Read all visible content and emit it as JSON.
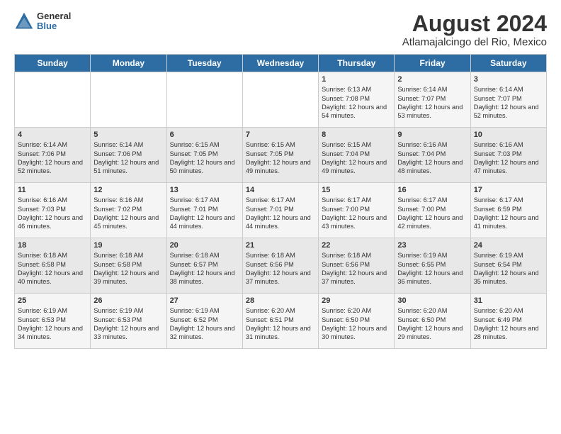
{
  "header": {
    "logo_general": "General",
    "logo_blue": "Blue",
    "main_title": "August 2024",
    "subtitle": "Atlamajalcingo del Rio, Mexico"
  },
  "days_of_week": [
    "Sunday",
    "Monday",
    "Tuesday",
    "Wednesday",
    "Thursday",
    "Friday",
    "Saturday"
  ],
  "weeks": [
    {
      "days": [
        {
          "num": "",
          "text": ""
        },
        {
          "num": "",
          "text": ""
        },
        {
          "num": "",
          "text": ""
        },
        {
          "num": "",
          "text": ""
        },
        {
          "num": "1",
          "text": "Sunrise: 6:13 AM\nSunset: 7:08 PM\nDaylight: 12 hours\nand 54 minutes."
        },
        {
          "num": "2",
          "text": "Sunrise: 6:14 AM\nSunset: 7:07 PM\nDaylight: 12 hours\nand 53 minutes."
        },
        {
          "num": "3",
          "text": "Sunrise: 6:14 AM\nSunset: 7:07 PM\nDaylight: 12 hours\nand 52 minutes."
        }
      ]
    },
    {
      "days": [
        {
          "num": "4",
          "text": "Sunrise: 6:14 AM\nSunset: 7:06 PM\nDaylight: 12 hours\nand 52 minutes."
        },
        {
          "num": "5",
          "text": "Sunrise: 6:14 AM\nSunset: 7:06 PM\nDaylight: 12 hours\nand 51 minutes."
        },
        {
          "num": "6",
          "text": "Sunrise: 6:15 AM\nSunset: 7:05 PM\nDaylight: 12 hours\nand 50 minutes."
        },
        {
          "num": "7",
          "text": "Sunrise: 6:15 AM\nSunset: 7:05 PM\nDaylight: 12 hours\nand 49 minutes."
        },
        {
          "num": "8",
          "text": "Sunrise: 6:15 AM\nSunset: 7:04 PM\nDaylight: 12 hours\nand 49 minutes."
        },
        {
          "num": "9",
          "text": "Sunrise: 6:16 AM\nSunset: 7:04 PM\nDaylight: 12 hours\nand 48 minutes."
        },
        {
          "num": "10",
          "text": "Sunrise: 6:16 AM\nSunset: 7:03 PM\nDaylight: 12 hours\nand 47 minutes."
        }
      ]
    },
    {
      "days": [
        {
          "num": "11",
          "text": "Sunrise: 6:16 AM\nSunset: 7:03 PM\nDaylight: 12 hours\nand 46 minutes."
        },
        {
          "num": "12",
          "text": "Sunrise: 6:16 AM\nSunset: 7:02 PM\nDaylight: 12 hours\nand 45 minutes."
        },
        {
          "num": "13",
          "text": "Sunrise: 6:17 AM\nSunset: 7:01 PM\nDaylight: 12 hours\nand 44 minutes."
        },
        {
          "num": "14",
          "text": "Sunrise: 6:17 AM\nSunset: 7:01 PM\nDaylight: 12 hours\nand 44 minutes."
        },
        {
          "num": "15",
          "text": "Sunrise: 6:17 AM\nSunset: 7:00 PM\nDaylight: 12 hours\nand 43 minutes."
        },
        {
          "num": "16",
          "text": "Sunrise: 6:17 AM\nSunset: 7:00 PM\nDaylight: 12 hours\nand 42 minutes."
        },
        {
          "num": "17",
          "text": "Sunrise: 6:17 AM\nSunset: 6:59 PM\nDaylight: 12 hours\nand 41 minutes."
        }
      ]
    },
    {
      "days": [
        {
          "num": "18",
          "text": "Sunrise: 6:18 AM\nSunset: 6:58 PM\nDaylight: 12 hours\nand 40 minutes."
        },
        {
          "num": "19",
          "text": "Sunrise: 6:18 AM\nSunset: 6:58 PM\nDaylight: 12 hours\nand 39 minutes."
        },
        {
          "num": "20",
          "text": "Sunrise: 6:18 AM\nSunset: 6:57 PM\nDaylight: 12 hours\nand 38 minutes."
        },
        {
          "num": "21",
          "text": "Sunrise: 6:18 AM\nSunset: 6:56 PM\nDaylight: 12 hours\nand 37 minutes."
        },
        {
          "num": "22",
          "text": "Sunrise: 6:18 AM\nSunset: 6:56 PM\nDaylight: 12 hours\nand 37 minutes."
        },
        {
          "num": "23",
          "text": "Sunrise: 6:19 AM\nSunset: 6:55 PM\nDaylight: 12 hours\nand 36 minutes."
        },
        {
          "num": "24",
          "text": "Sunrise: 6:19 AM\nSunset: 6:54 PM\nDaylight: 12 hours\nand 35 minutes."
        }
      ]
    },
    {
      "days": [
        {
          "num": "25",
          "text": "Sunrise: 6:19 AM\nSunset: 6:53 PM\nDaylight: 12 hours\nand 34 minutes."
        },
        {
          "num": "26",
          "text": "Sunrise: 6:19 AM\nSunset: 6:53 PM\nDaylight: 12 hours\nand 33 minutes."
        },
        {
          "num": "27",
          "text": "Sunrise: 6:19 AM\nSunset: 6:52 PM\nDaylight: 12 hours\nand 32 minutes."
        },
        {
          "num": "28",
          "text": "Sunrise: 6:20 AM\nSunset: 6:51 PM\nDaylight: 12 hours\nand 31 minutes."
        },
        {
          "num": "29",
          "text": "Sunrise: 6:20 AM\nSunset: 6:50 PM\nDaylight: 12 hours\nand 30 minutes."
        },
        {
          "num": "30",
          "text": "Sunrise: 6:20 AM\nSunset: 6:50 PM\nDaylight: 12 hours\nand 29 minutes."
        },
        {
          "num": "31",
          "text": "Sunrise: 6:20 AM\nSunset: 6:49 PM\nDaylight: 12 hours\nand 28 minutes."
        }
      ]
    }
  ]
}
